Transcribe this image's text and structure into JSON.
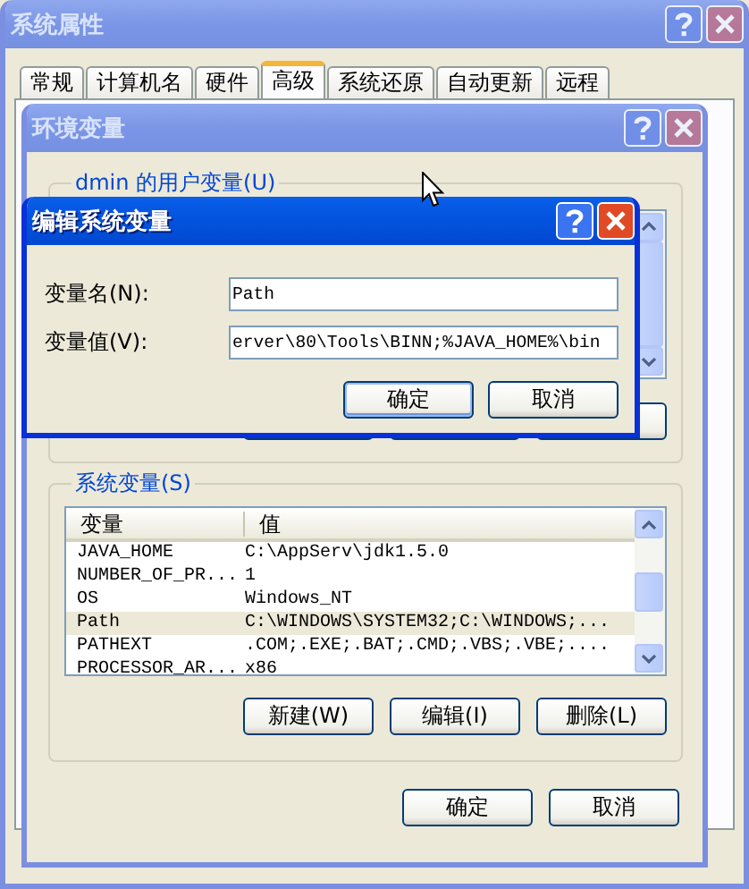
{
  "system_properties": {
    "title": "系统属性",
    "active": false,
    "tabs": [
      {
        "label": "常规",
        "selected": false
      },
      {
        "label": "计算机名",
        "selected": false
      },
      {
        "label": "硬件",
        "selected": false
      },
      {
        "label": "高级",
        "selected": true
      },
      {
        "label": "系统还原",
        "selected": false
      },
      {
        "label": "自动更新",
        "selected": false
      },
      {
        "label": "远程",
        "selected": false
      }
    ]
  },
  "environment_variables": {
    "title": "环境变量",
    "active": false,
    "user_variables": {
      "label": "dmin 的用户变量(U)"
    },
    "system_variables": {
      "label": "系统变量(S)",
      "columns": [
        "变量",
        "值"
      ],
      "rows": [
        {
          "name": "JAVA_HOME",
          "value": "C:\\AppServ\\jdk1.5.0",
          "selected": false
        },
        {
          "name": "NUMBER_OF_PR...",
          "value": "1",
          "selected": false
        },
        {
          "name": "OS",
          "value": "Windows_NT",
          "selected": false
        },
        {
          "name": "Path",
          "value": "C:\\WINDOWS\\SYSTEM32;C:\\WINDOWS;...",
          "selected": true
        },
        {
          "name": "PATHEXT",
          "value": ".COM;.EXE;.BAT;.CMD;.VBS;.VBE;....",
          "selected": false
        },
        {
          "name": "PROCESSOR_AR...",
          "value": "x86",
          "selected": false
        }
      ],
      "buttons": [
        "新建(W)",
        "编辑(I)",
        "删除(L)"
      ]
    },
    "buttons": [
      "确定",
      "取消"
    ]
  },
  "edit_dialog": {
    "title": "编辑系统变量",
    "active": true,
    "fields": [
      {
        "label": "变量名(N):",
        "value": "Path"
      },
      {
        "label": "变量值(V):",
        "value": "erver\\80\\Tools\\BINN;%JAVA_HOME%\\bin"
      }
    ],
    "buttons": [
      "确定",
      "取消"
    ]
  }
}
